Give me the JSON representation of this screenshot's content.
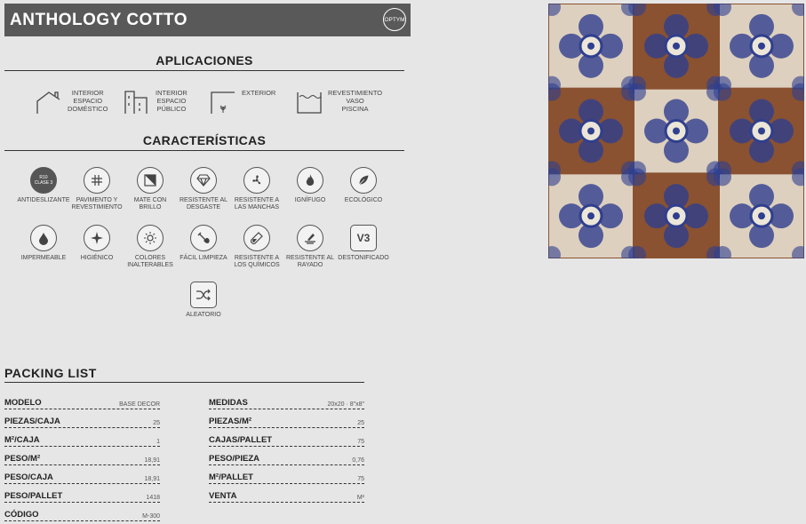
{
  "header": {
    "title": "ANTHOLOGY COTTO",
    "logo": "OPTYM"
  },
  "aplicaciones": {
    "title": "APLICACIONES",
    "items": [
      {
        "label": "INTERIOR\nESPACIO\nDOMÉSTICO",
        "icon": "house-icon"
      },
      {
        "label": "INTERIOR\nESPACIO\nPÚBLICO",
        "icon": "building-icon"
      },
      {
        "label": "EXTERIOR",
        "icon": "exterior-icon"
      },
      {
        "label": "REVESTIMIENTO\nVASO\nPISCINA",
        "icon": "pool-icon"
      }
    ]
  },
  "caracteristicas": {
    "title": "CARACTERÍSTICAS",
    "badge": {
      "line1": "R10",
      "line2": "CLASE 3"
    },
    "items": [
      {
        "label": "ANTIDESLIZANTE"
      },
      {
        "label": "PAVIMENTO Y\nREVESTIMIENTO"
      },
      {
        "label": "MATE CON\nBRILLO"
      },
      {
        "label": "RESISTENTE AL\nDESGASTE"
      },
      {
        "label": "RESISTENTE A\nLAS MANCHAS"
      },
      {
        "label": "IGNÍFUGO"
      },
      {
        "label": "ECOLÓGICO"
      },
      {
        "label": "IMPERMEABLE"
      },
      {
        "label": "HIGIÉNICO"
      },
      {
        "label": "COLORES\nINALTERABLES"
      },
      {
        "label": "FÁCIL LIMPIEZA"
      },
      {
        "label": "RESISTENTE A\nLOS QUÍMICOS"
      },
      {
        "label": "RESISTENTE AL\nRAYADO"
      },
      {
        "label": "DESTONIFICADO"
      },
      {
        "label": "ALEATORIO"
      }
    ],
    "v_mark": "V3"
  },
  "packing": {
    "title": "PACKING LIST",
    "left": [
      {
        "k": "MODELO",
        "v": "BASE DECOR"
      },
      {
        "k": "PIEZAS/CAJA",
        "v": "25"
      },
      {
        "k": "M²/CAJA",
        "v": "1"
      },
      {
        "k": "PESO/M²",
        "v": "18,91"
      },
      {
        "k": "PESO/CAJA",
        "v": "18,91"
      },
      {
        "k": "PESO/PALLET",
        "v": "1418"
      },
      {
        "k": "CÓDIGO",
        "v": "M-300"
      }
    ],
    "right": [
      {
        "k": "MEDIDAS",
        "v": "20x20 · 8\"x8\""
      },
      {
        "k": "PIEZAS/M²",
        "v": "25"
      },
      {
        "k": "CAJAS/PALLET",
        "v": "75"
      },
      {
        "k": "PESO/PIEZA",
        "v": "0,76"
      },
      {
        "k": "M²/PALLET",
        "v": "75"
      },
      {
        "k": "VENTA",
        "v": "M²"
      }
    ]
  },
  "colors": {
    "header_bg": "#595959",
    "tile_terracotta": "#8a5230",
    "tile_blue": "#2f3f8f",
    "tile_cream": "#ece6d8"
  }
}
